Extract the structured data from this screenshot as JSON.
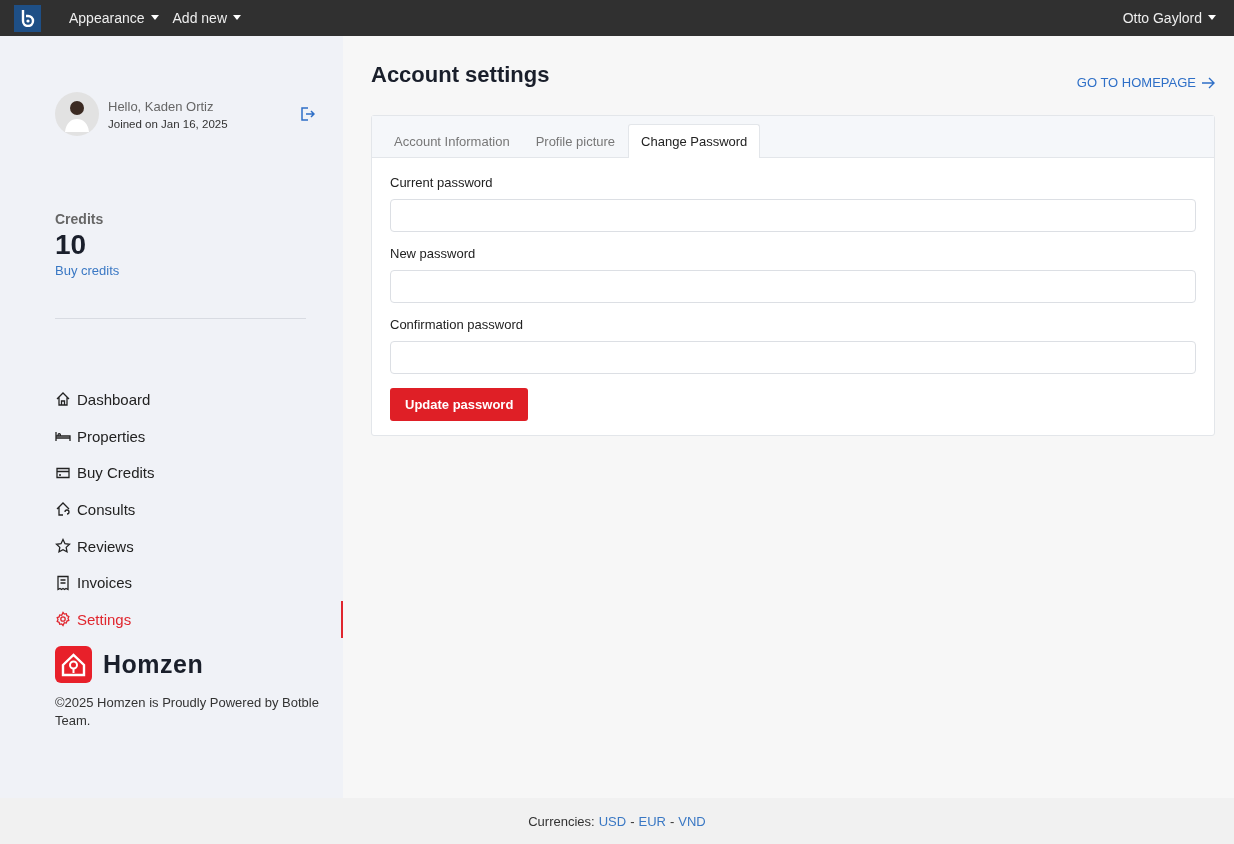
{
  "topbar": {
    "menus": [
      {
        "label": "Appearance"
      },
      {
        "label": "Add new"
      }
    ],
    "user": "Otto Gaylord"
  },
  "profile": {
    "greeting": "Hello, Kaden Ortiz",
    "joined": "Joined on Jan 16, 2025"
  },
  "credits": {
    "label": "Credits",
    "value": "10",
    "link": "Buy credits"
  },
  "nav": [
    {
      "label": "Dashboard",
      "selected": false
    },
    {
      "label": "Properties",
      "selected": false
    },
    {
      "label": "Buy Credits",
      "selected": false
    },
    {
      "label": "Consults",
      "selected": false
    },
    {
      "label": "Reviews",
      "selected": false
    },
    {
      "label": "Invoices",
      "selected": false
    },
    {
      "label": "Settings",
      "selected": true
    }
  ],
  "brand": {
    "name": "Homzen",
    "copyright": "©2025 Homzen is Proudly Powered by Botble Team."
  },
  "page": {
    "title": "Account settings",
    "homepage_link": "GO TO HOMEPAGE"
  },
  "tabs": [
    {
      "label": "Account Information",
      "selected": false
    },
    {
      "label": "Profile picture",
      "selected": false
    },
    {
      "label": "Change Password",
      "selected": true
    }
  ],
  "fields": [
    {
      "label": "Current password"
    },
    {
      "label": "New password"
    },
    {
      "label": "Confirmation password"
    }
  ],
  "submit": "Update password",
  "footer": {
    "label": "Currencies:",
    "currencies": [
      "USD",
      "EUR",
      "VND"
    ],
    "separators": [
      "-",
      "-"
    ]
  }
}
